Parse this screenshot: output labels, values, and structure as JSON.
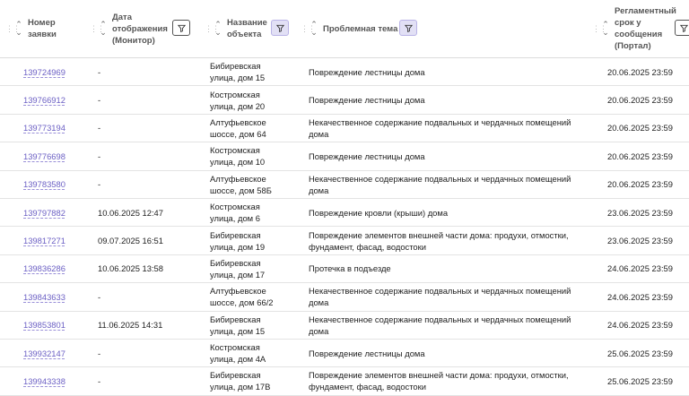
{
  "columns": [
    {
      "label": "Номер\nзаявки",
      "filter": false
    },
    {
      "label": "Дата\nотображения\n(Монитор)",
      "filter": true,
      "filter_active": false
    },
    {
      "label": "Название\nобъекта",
      "filter": true,
      "filter_active": true
    },
    {
      "label": "Проблемная тема",
      "filter": true,
      "filter_active": true
    },
    {
      "label": "Регламентный\nсрок у\nсообщения\n(Портал)",
      "filter": true,
      "filter_active": false
    }
  ],
  "rows": [
    {
      "id": "139724969",
      "date": "-",
      "object": "Бибиревская\nулица, дом 15",
      "topic": "Повреждение лестницы дома",
      "deadline": "20.06.2025 23:59"
    },
    {
      "id": "139766912",
      "date": "-",
      "object": "Костромская\nулица, дом 20",
      "topic": "Повреждение лестницы дома",
      "deadline": "20.06.2025 23:59"
    },
    {
      "id": "139773194",
      "date": "-",
      "object": "Алтуфьевское\nшоссе, дом 64",
      "topic": "Некачественное содержание подвальных и чердачных помещений\nдома",
      "deadline": "20.06.2025 23:59"
    },
    {
      "id": "139776698",
      "date": "-",
      "object": "Костромская\nулица, дом 10",
      "topic": "Повреждение лестницы дома",
      "deadline": "20.06.2025 23:59"
    },
    {
      "id": "139783580",
      "date": "-",
      "object": "Алтуфьевское\nшоссе, дом 58Б",
      "topic": "Некачественное содержание подвальных и чердачных помещений\nдома",
      "deadline": "20.06.2025 23:59"
    },
    {
      "id": "139797882",
      "date": "10.06.2025 12:47",
      "object": "Костромская\nулица, дом 6",
      "topic": "Повреждение кровли (крыши) дома",
      "deadline": "23.06.2025 23:59"
    },
    {
      "id": "139817271",
      "date": "09.07.2025 16:51",
      "object": "Бибиревская\nулица, дом 19",
      "topic": "Повреждение элементов внешней части дома: продухи, отмостки,\nфундамент, фасад, водостоки",
      "deadline": "23.06.2025 23:59"
    },
    {
      "id": "139836286",
      "date": "10.06.2025 13:58",
      "object": "Бибиревская\nулица, дом 17",
      "topic": "Протечка в подъезде",
      "deadline": "24.06.2025 23:59"
    },
    {
      "id": "139843633",
      "date": "-",
      "object": "Алтуфьевское\nшоссе, дом 66/2",
      "topic": "Некачественное содержание подвальных и чердачных помещений\nдома",
      "deadline": "24.06.2025 23:59"
    },
    {
      "id": "139853801",
      "date": "11.06.2025 14:31",
      "object": "Бибиревская\nулица, дом 15",
      "topic": "Некачественное содержание подвальных и чердачных помещений\nдома",
      "deadline": "24.06.2025 23:59"
    },
    {
      "id": "139932147",
      "date": "-",
      "object": "Костромская\nулица, дом 4А",
      "topic": "Повреждение лестницы дома",
      "deadline": "25.06.2025 23:59"
    },
    {
      "id": "139943338",
      "date": "-",
      "object": "Бибиревская\nулица, дом 17В",
      "topic": "Повреждение элементов внешней части дома: продухи, отмостки,\nфундамент, фасад, водостоки",
      "deadline": "25.06.2025 23:59"
    }
  ]
}
